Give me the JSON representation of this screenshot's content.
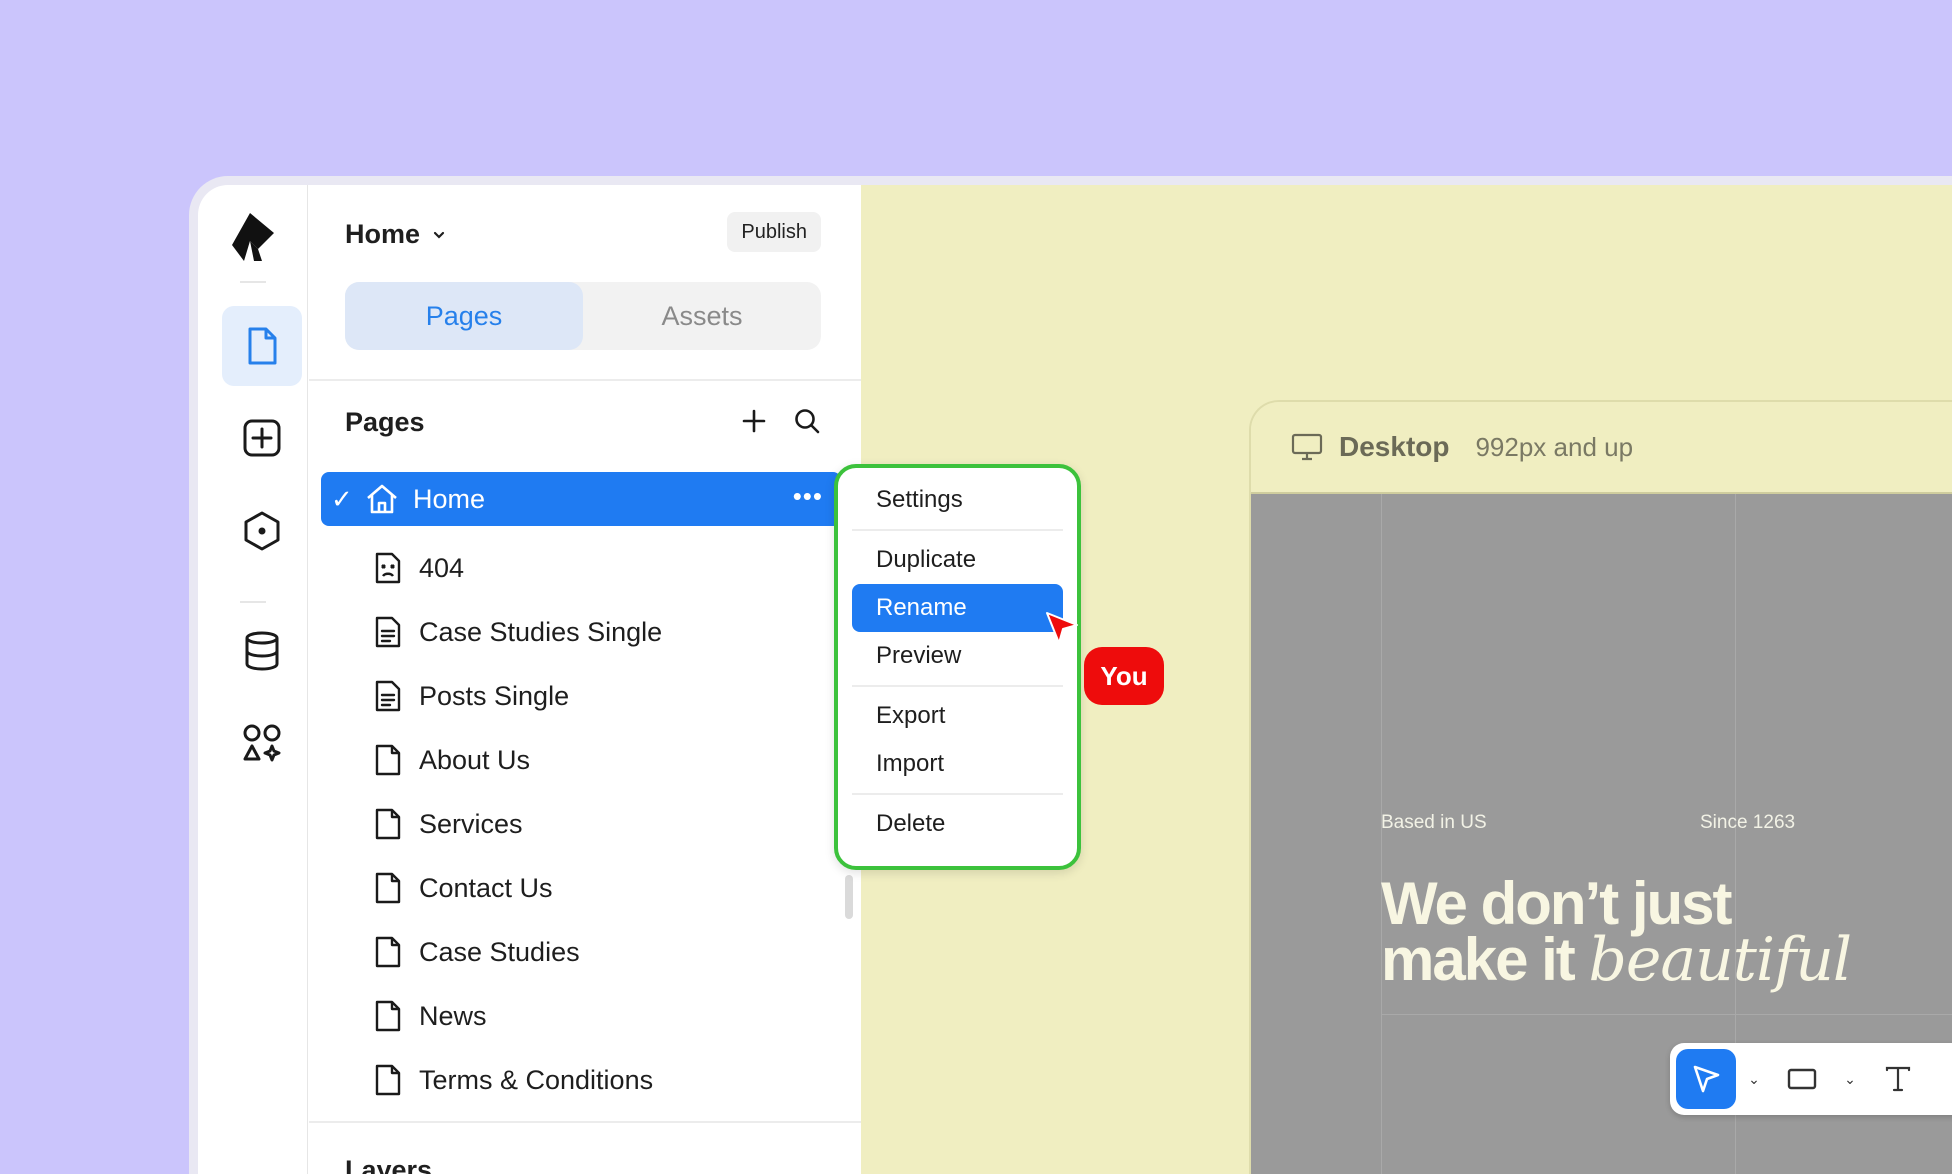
{
  "header": {
    "title": "Home",
    "publish_label": "Publish"
  },
  "tabs": [
    {
      "label": "Pages",
      "active": true
    },
    {
      "label": "Assets",
      "active": false
    }
  ],
  "pages_section": {
    "title": "Pages"
  },
  "pages": [
    {
      "label": "Home",
      "icon": "home-icon",
      "selected": true
    },
    {
      "label": "404",
      "icon": "error-page-icon"
    },
    {
      "label": "Case Studies Single",
      "icon": "template-page-icon"
    },
    {
      "label": "Posts Single",
      "icon": "template-page-icon"
    },
    {
      "label": "About Us",
      "icon": "page-icon"
    },
    {
      "label": "Services",
      "icon": "page-icon"
    },
    {
      "label": "Contact Us",
      "icon": "page-icon"
    },
    {
      "label": "Case Studies",
      "icon": "page-icon"
    },
    {
      "label": "News",
      "icon": "page-icon"
    },
    {
      "label": "Terms & Conditions",
      "icon": "page-icon"
    }
  ],
  "layers_section": {
    "title": "Layers"
  },
  "context_menu": {
    "items": [
      "Settings",
      "Duplicate",
      "Rename",
      "Preview",
      "Export",
      "Import",
      "Delete"
    ],
    "active": "Rename"
  },
  "cursor_badge": "You",
  "canvas": {
    "breakpoint_name": "Desktop",
    "breakpoint_range": "992px and up",
    "tag_left": "Based in US",
    "tag_right": "Since 1263",
    "hero_line1": "We don’t just",
    "hero_line2": "make it",
    "hero_script": "beautiful"
  },
  "colors": {
    "accent": "#1f7bf2",
    "background": "#cbc5fc",
    "canvas": "#f0eec1",
    "menu_border": "#3cc23c",
    "badge": "#ee0c0c"
  }
}
